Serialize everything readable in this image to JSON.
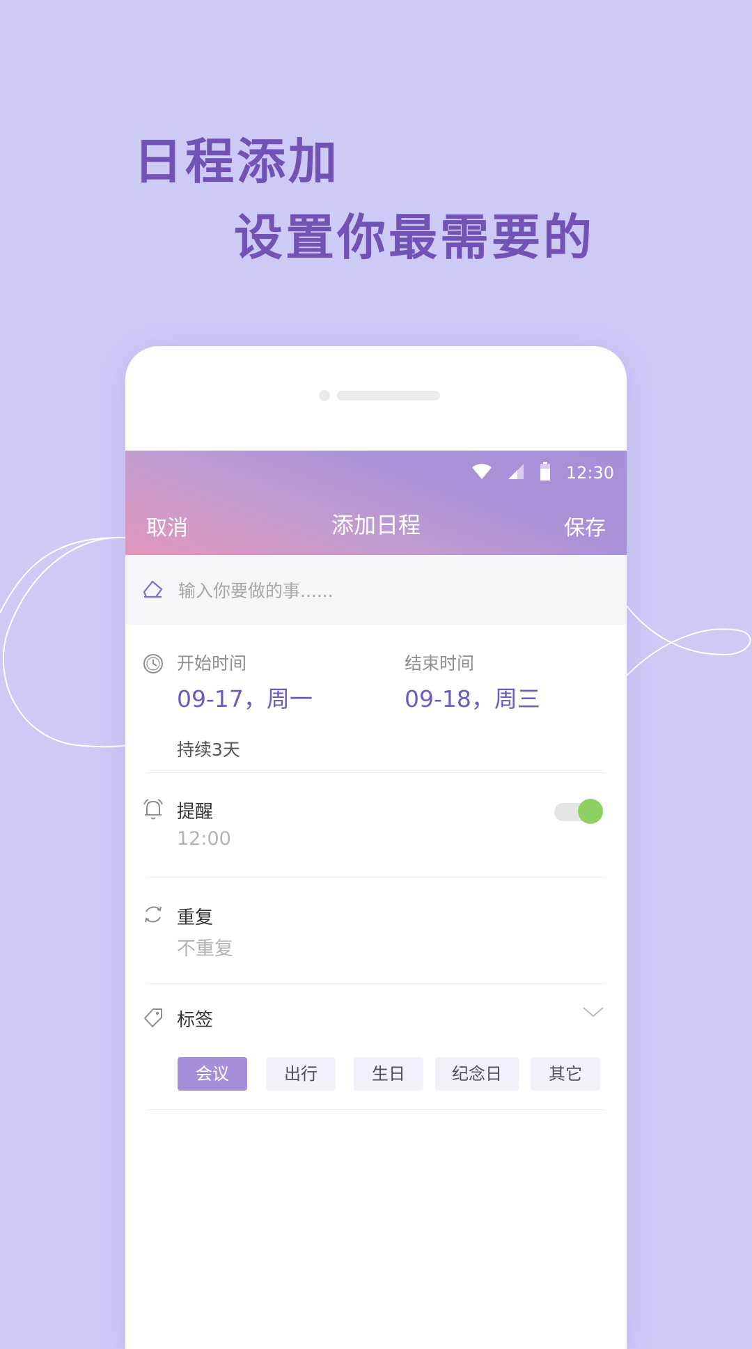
{
  "promo": {
    "headline_1": "日程添加",
    "headline_2": "设置你最需要的"
  },
  "status_bar": {
    "time": "12:30"
  },
  "nav": {
    "cancel": "取消",
    "title": "添加日程",
    "save": "保存"
  },
  "todo_input": {
    "placeholder": "输入你要做的事......",
    "value": ""
  },
  "time": {
    "start_label": "开始时间",
    "start_value": "09-17，周一",
    "end_label": "结束时间",
    "end_value": "09-18，周三",
    "duration": "持续3天"
  },
  "reminder": {
    "label": "提醒",
    "value": "12:00",
    "enabled": true
  },
  "repeat": {
    "label": "重复",
    "value": "不重复"
  },
  "tags": {
    "label": "标签",
    "items": [
      "会议",
      "出行",
      "生日",
      "纪念日",
      "其它"
    ],
    "selected": "会议"
  },
  "colors": {
    "background": "#cdcaf6",
    "headline": "#7352b6",
    "accent": "#6a5bc5",
    "tag_active": "#a58fd8",
    "toggle_on": "#8ed163"
  },
  "icons": [
    "wifi-icon",
    "cellular-signal-icon",
    "battery-icon",
    "edit-icon",
    "clock-icon",
    "bell-icon",
    "repeat-icon",
    "tag-icon",
    "chevron-down-icon"
  ]
}
